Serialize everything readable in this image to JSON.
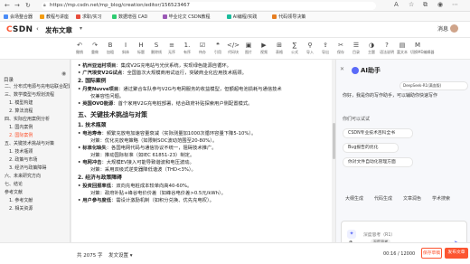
{
  "browser": {
    "url": "https://mp.csdn.net/mp_blog/creation/editor/156523467",
    "bookmarks": [
      "会场整合器",
      "教程与讲座",
      "求职/实习",
      "数据增强 CAD",
      "毕业论文 CSDN教程",
      "AI编程/实践",
      "代码领导决策"
    ]
  },
  "header": {
    "logo_c": "C",
    "logo_rest": "SDN",
    "back": "‹",
    "title": "发布文章",
    "caret": "▾",
    "user_label": "消息"
  },
  "toolbar": {
    "items": [
      {
        "glyph": "↶",
        "label": "撤销"
      },
      {
        "glyph": "↷",
        "label": "重做"
      },
      {
        "glyph": "B",
        "label": "加粗"
      },
      {
        "glyph": "I",
        "label": "斜体"
      },
      {
        "glyph": "H",
        "label": "标题"
      },
      {
        "glyph": "S",
        "label": "删除线"
      },
      {
        "glyph": "≡",
        "label": "无序"
      },
      {
        "glyph": "1.",
        "label": "有序"
      },
      {
        "glyph": "☑",
        "label": "待办"
      },
      {
        "glyph": "❝",
        "label": "引用"
      },
      {
        "glyph": "</>",
        "label": "代码块"
      },
      {
        "glyph": "▣",
        "label": "图片"
      },
      {
        "glyph": "▶",
        "label": "视频"
      },
      {
        "glyph": "⊞",
        "label": "表格"
      },
      {
        "glyph": "∑",
        "label": "公式"
      },
      {
        "glyph": "⚲",
        "label": "导入"
      },
      {
        "glyph": "⇪",
        "label": "导出"
      },
      {
        "glyph": "✂",
        "label": "保存"
      },
      {
        "glyph": "☰",
        "label": "目录"
      },
      {
        "glyph": "◑",
        "label": "主题"
      },
      {
        "glyph": "?",
        "label": "语法说明"
      },
      {
        "glyph": "▤",
        "label": "富文本"
      },
      {
        "glyph": "M",
        "label": "切换MD编辑器"
      }
    ]
  },
  "outline": {
    "heading": "目录",
    "items": [
      {
        "text": "二、分布式电源与充电站联合配置的意义",
        "level": 1,
        "active": false
      },
      {
        "text": "三、数学模型与规划流程",
        "level": 1,
        "active": false
      },
      {
        "text": "1. 模型构建",
        "level": 2,
        "active": false
      },
      {
        "text": "2. 算法流程",
        "level": 2,
        "active": false
      },
      {
        "text": "四、实际应用案例分析",
        "level": 1,
        "active": false
      },
      {
        "text": "1. 国内案例",
        "level": 2,
        "active": false
      },
      {
        "text": "2. 国际案例",
        "level": 2,
        "active": true
      },
      {
        "text": "五、关键技术挑战与对策",
        "level": 1,
        "active": false
      },
      {
        "text": "1. 技术瓶颈",
        "level": 2,
        "active": false
      },
      {
        "text": "2. 政策与市场",
        "level": 2,
        "active": false
      },
      {
        "text": "3. 经济与政策障碍",
        "level": 2,
        "active": false
      },
      {
        "text": "六、未来研究方向",
        "level": 1,
        "active": false
      },
      {
        "text": "七、结论",
        "level": 1,
        "active": false
      },
      {
        "text": "参考文献",
        "level": 1,
        "active": false
      },
      {
        "text": "1. 参考文献",
        "level": 2,
        "active": false
      },
      {
        "text": "2. 相关资源",
        "level": 2,
        "active": false
      }
    ]
  },
  "editor": {
    "lines": [
      {
        "type": "bul",
        "bold": "杭州亚运村项目",
        "text": "：集成V2G充电站与光伏系统，实现绿色能源自循环。"
      },
      {
        "type": "bul",
        "bold": "广汽埃安V2G试点",
        "text": "：全国首次大规模商用试运行，突破商业化应用技术瓶颈。"
      },
      {
        "type": "h3",
        "text": "2. 国际案例"
      },
      {
        "type": "bul",
        "bold": "丹麦Nuvve项目",
        "text": "：通过聚合车队参与V2G与电网服务的收益模型，但额超电池损耗与通信技术"
      },
      {
        "type": "sub",
        "text": "仅兼容性问题。"
      },
      {
        "type": "bul",
        "bold": "英国OVO能源",
        "text": "：首个家用V2G充电桩部署，结合政府补贴探索用户侧配置模式。"
      },
      {
        "type": "h2",
        "text": "五、关键技术挑战与对策"
      },
      {
        "type": "h3",
        "text": "1. 技术瓶颈"
      },
      {
        "type": "bul",
        "bold": "电池寿命",
        "text": "：频繁充放电加速容量衰减（实际测量加1000次循环容量下降5-10%）。"
      },
      {
        "type": "sub",
        "text": "对策：优化充放电策略（如限制SOC波动范围至20-80%）。"
      },
      {
        "type": "bul",
        "bold": "标准化缺失",
        "text": "：各国电网代码与通信协议不统一，阻碍技术推广。"
      },
      {
        "type": "sub",
        "text": "对策：推动国际标准（如IEC 61851-23）制定。"
      },
      {
        "type": "bul",
        "bold": "电网冲击",
        "text": "：大规模EV接入可能导致谐波和电压波动。"
      },
      {
        "type": "sub",
        "text": "对策：采用双级式逆变器降低谐波（THD<3%）。"
      },
      {
        "type": "h3",
        "text": "2. 经济与政策障碍"
      },
      {
        "type": "bul",
        "bold": "投资回报率低",
        "text": "：双向充电桩成本较单向高40-60%。"
      },
      {
        "type": "sub",
        "text": "对策：政府补贴+峰谷电价价差（如峰谷电价差>0.5元/kWh）。"
      },
      {
        "type": "bul",
        "bold": "用户参与度低",
        "text": "：需设计激励机制（如积分兑换、优先充电权）。"
      }
    ]
  },
  "ai": {
    "title": "AI助手",
    "model": "DeepSeek-R1(满血版)",
    "greeting": "你好，我是你的写作助手，可以辅助你快速写作",
    "suggest_head": "你们可以试试",
    "chips": [
      "CSDN专业技术百科全书",
      "Bug报告的优化",
      "你对文件自动化管理方面"
    ],
    "tools": [
      "大纲生成",
      "代码生成",
      "文章润色",
      "学术搜索"
    ],
    "placeholder": "深度思考（R1）",
    "input_icon": "✦",
    "bar_left": "⊕",
    "pill": "深度思考",
    "send": "➤",
    "close": "✕"
  },
  "status": {
    "word_count": "共 2075 字",
    "publish_settings": "发文设置 ▾",
    "timer": "00:16 / 12000",
    "save_draft": "保存草稿",
    "publish": "发布文章"
  },
  "colors": {
    "accent": "#fc5531",
    "ai_accent": "#5a6af8"
  }
}
